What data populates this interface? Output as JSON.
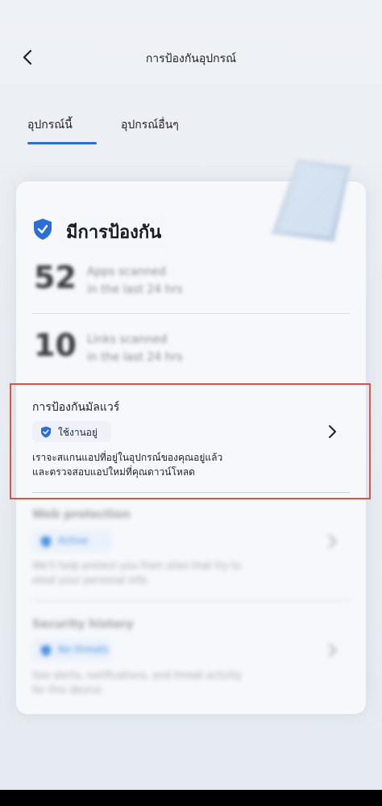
{
  "header": {
    "title": "การป้องกันอุปกรณ์",
    "back_icon": "chevron-left-icon"
  },
  "tabs": [
    {
      "label": "อุปกรณ์นี้",
      "active": true
    },
    {
      "label": "อุปกรณ์อื่นๆ",
      "active": false
    }
  ],
  "status": {
    "label": "มีการป้องกัน",
    "icon": "shield-check-icon",
    "accent": "#2a6fd6"
  },
  "stats": [
    {
      "value": "52",
      "label_line1": "Apps scanned",
      "label_line2": "in the last 24 hrs"
    },
    {
      "value": "10",
      "label_line1": "Links scanned",
      "label_line2": "in the last 24 hrs"
    }
  ],
  "malware": {
    "title": "การป้องกันมัลแวร์",
    "badge": "ใช้งานอยู่",
    "desc_line1": "เราจะสแกนแอปที่อยู่ในอุปกรณ์ของคุณอยู่แล้ว",
    "desc_line2": "และตรวจสอบแอปใหม่ที่คุณดาวน์โหลด",
    "highlight_color": "#d9534f"
  },
  "web": {
    "title": "Web protection",
    "badge": "Active",
    "desc_line1": "We'll help protect you from sites that try to",
    "desc_line2": "steal your personal info."
  },
  "history": {
    "title": "Security history",
    "badge": "No threats",
    "desc_line1": "See alerts, notifications, and threat activity",
    "desc_line2": "for this device."
  }
}
